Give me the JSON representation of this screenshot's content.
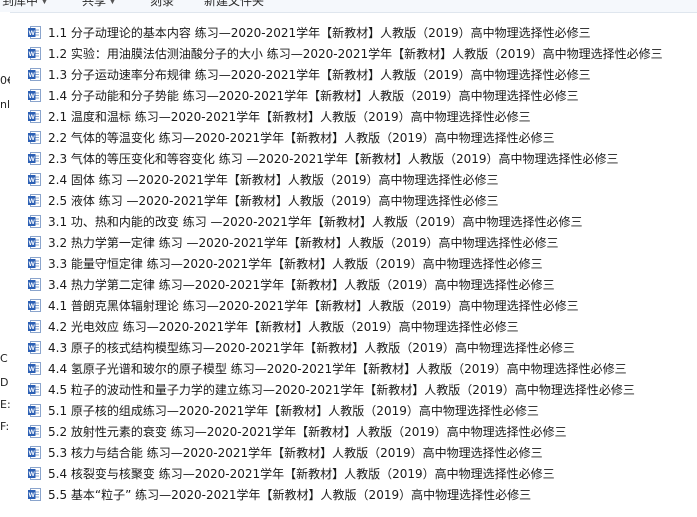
{
  "toolbar": {
    "share_to_label": "到库中",
    "share_label": "共享",
    "burn_label": "刻录",
    "new_folder_label": "新建文件夹"
  },
  "left_pane": {
    "fragments": [
      "0€",
      "nl",
      "C",
      "D",
      "E:",
      "F:"
    ]
  },
  "files": [
    {
      "name": "1.1 分子动理论的基本内容 练习—2020-2021学年【新教材】人教版（2019）高中物理选择性必修三",
      "icon": "word-doc-icon"
    },
    {
      "name": "1.2 实验：用油膜法估测油酸分子的大小 练习—2020-2021学年【新教材】人教版（2019）高中物理选择性必修三",
      "icon": "word-doc-icon"
    },
    {
      "name": "1.3 分子运动速率分布规律 练习—2020-2021学年【新教材】人教版（2019）高中物理选择性必修三",
      "icon": "word-doc-icon"
    },
    {
      "name": "1.4 分子动能和分子势能  练习—2020-2021学年【新教材】人教版（2019）高中物理选择性必修三",
      "icon": "word-doc-icon"
    },
    {
      "name": "2.1 温度和温标 练习—2020-2021学年【新教材】人教版（2019）高中物理选择性必修三",
      "icon": "word-doc-icon"
    },
    {
      "name": "2.2 气体的等温变化 练习—2020-2021学年【新教材】人教版（2019）高中物理选择性必修三",
      "icon": "word-doc-icon"
    },
    {
      "name": "2.3 气体的等压变化和等容变化  练习 —2020-2021学年【新教材】人教版（2019）高中物理选择性必修三",
      "icon": "word-doc-icon"
    },
    {
      "name": "2.4 固体 练习 —2020-2021学年【新教材】人教版（2019）高中物理选择性必修三",
      "icon": "word-doc-icon"
    },
    {
      "name": "2.5 液体 练习 —2020-2021学年【新教材】人教版（2019）高中物理选择性必修三",
      "icon": "word-doc-icon"
    },
    {
      "name": "3.1 功、热和内能的改变 练习 —2020-2021学年【新教材】人教版（2019）高中物理选择性必修三",
      "icon": "word-doc-icon"
    },
    {
      "name": "3.2 热力学第一定律 练习 —2020-2021学年【新教材】人教版（2019）高中物理选择性必修三",
      "icon": "word-doc-icon"
    },
    {
      "name": "3.3 能量守恒定律 练习—2020-2021学年【新教材】人教版（2019）高中物理选择性必修三",
      "icon": "word-doc-icon"
    },
    {
      "name": "3.4 热力学第二定律 练习—2020-2021学年【新教材】人教版（2019）高中物理选择性必修三",
      "icon": "word-doc-icon"
    },
    {
      "name": "4.1 普朗克黑体辐射理论 练习—2020-2021学年【新教材】人教版（2019）高中物理选择性必修三",
      "icon": "word-doc-icon"
    },
    {
      "name": "4.2 光电效应 练习—2020-2021学年【新教材】人教版（2019）高中物理选择性必修三",
      "icon": "word-doc-icon"
    },
    {
      "name": "4.3 原子的核式结构模型练习—2020-2021学年【新教材】人教版（2019）高中物理选择性必修三",
      "icon": "word-doc-icon"
    },
    {
      "name": "4.4 氢原子光谱和玻尔的原子模型 练习—2020-2021学年【新教材】人教版（2019）高中物理选择性必修三",
      "icon": "word-doc-icon"
    },
    {
      "name": "4.5 粒子的波动性和量子力学的建立练习—2020-2021学年【新教材】人教版（2019）高中物理选择性必修三",
      "icon": "word-doc-icon"
    },
    {
      "name": "5.1 原子核的组成练习—2020-2021学年【新教材】人教版（2019）高中物理选择性必修三",
      "icon": "word-doc-icon"
    },
    {
      "name": "5.2 放射性元素的衰变 练习—2020-2021学年【新教材】人教版（2019）高中物理选择性必修三",
      "icon": "word-doc-icon"
    },
    {
      "name": "5.3 核力与结合能  练习—2020-2021学年【新教材】人教版（2019）高中物理选择性必修三",
      "icon": "word-doc-icon"
    },
    {
      "name": "5.4 核裂变与核聚变 练习—2020-2021学年【新教材】人教版（2019）高中物理选择性必修三",
      "icon": "word-doc-icon"
    },
    {
      "name": "5.5 基本“粒子” 练习—2020-2021学年【新教材】人教版（2019）高中物理选择性必修三",
      "icon": "word-doc-icon"
    }
  ],
  "colors": {
    "word_icon_blue": "#2b5fb4",
    "toolbar_bg": "#f5f8fc"
  }
}
